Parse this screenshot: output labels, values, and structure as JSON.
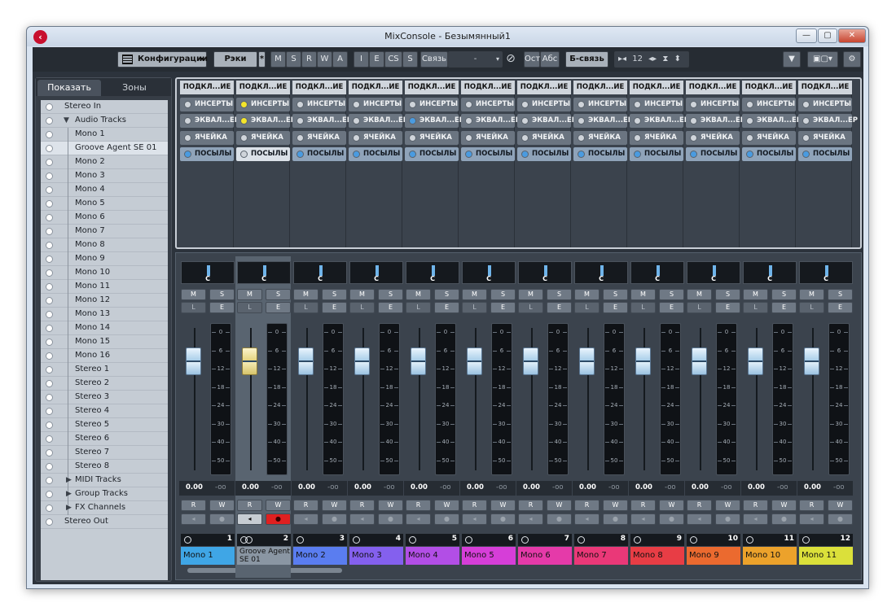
{
  "window": {
    "title": "MixConsole - Безымянный1"
  },
  "toolbar": {
    "config_label": "Конфигурации",
    "racks_label": "Рэки",
    "star": "*",
    "m": "M",
    "s": "S",
    "r": "R",
    "w": "W",
    "a": "A",
    "i": "I",
    "e": "E",
    "cs": "CS",
    "s2": "S",
    "link_label": "Связь",
    "link_value": "-",
    "ost_label": "Ост",
    "abs_label": "Абс",
    "b_link_label": "Б-связь",
    "width_value": "12"
  },
  "left_panel": {
    "tabs": [
      "Показать",
      "Зоны"
    ],
    "active_tab": 0,
    "items": [
      {
        "label": "Stereo In",
        "level": 0
      },
      {
        "label": "Audio Tracks",
        "level": 0,
        "expanded": true
      },
      {
        "label": "Mono 1",
        "level": 1
      },
      {
        "label": "Groove Agent SE 01",
        "level": 1,
        "selected": true
      },
      {
        "label": "Mono 2",
        "level": 1
      },
      {
        "label": "Mono 3",
        "level": 1
      },
      {
        "label": "Mono 4",
        "level": 1
      },
      {
        "label": "Mono 5",
        "level": 1
      },
      {
        "label": "Mono 6",
        "level": 1
      },
      {
        "label": "Mono 7",
        "level": 1
      },
      {
        "label": "Mono 8",
        "level": 1
      },
      {
        "label": "Mono 9",
        "level": 1
      },
      {
        "label": "Mono 10",
        "level": 1
      },
      {
        "label": "Mono 11",
        "level": 1
      },
      {
        "label": "Mono 12",
        "level": 1
      },
      {
        "label": "Mono 13",
        "level": 1
      },
      {
        "label": "Mono 14",
        "level": 1
      },
      {
        "label": "Mono 15",
        "level": 1
      },
      {
        "label": "Mono 16",
        "level": 1
      },
      {
        "label": "Stereo 1",
        "level": 1
      },
      {
        "label": "Stereo 2",
        "level": 1
      },
      {
        "label": "Stereo 3",
        "level": 1
      },
      {
        "label": "Stereo 4",
        "level": 1
      },
      {
        "label": "Stereo 5",
        "level": 1
      },
      {
        "label": "Stereo 6",
        "level": 1
      },
      {
        "label": "Stereo 7",
        "level": 1
      },
      {
        "label": "Stereo 8",
        "level": 1
      },
      {
        "label": "MIDI Tracks",
        "level": 1,
        "collapsed": true
      },
      {
        "label": "Group Tracks",
        "level": 1,
        "collapsed": true
      },
      {
        "label": "FX Channels",
        "level": 1,
        "collapsed": true
      },
      {
        "label": "Stereo Out",
        "level": 0
      }
    ]
  },
  "racks": {
    "routing": "ПОДКЛ...ИЕ",
    "inserts": "ИНСЕРТЫ",
    "eq": "ЭКВАЛ...ЕР",
    "strip": "ЯЧЕЙКА",
    "sends": "ПОСЫЛЫ"
  },
  "channel_common": {
    "pan_label": "C",
    "m": "M",
    "s": "S",
    "l": "L",
    "e": "E",
    "r": "R",
    "w": "W",
    "volume": "0.00",
    "peak": "-oo",
    "meter_scale": [
      "0",
      "6",
      "12",
      "18",
      "24",
      "30",
      "40",
      "50"
    ]
  },
  "channels": [
    {
      "number": "1",
      "name": "Mono 1",
      "color": "#3fa6e6",
      "eq_led": "off",
      "insert_led": "off"
    },
    {
      "number": "2",
      "name": "Groove Agent SE 01",
      "color": "#8a96a3",
      "eq_led": "yellow",
      "insert_led": "yellow",
      "selected": true,
      "record": true,
      "instrument": true
    },
    {
      "number": "3",
      "name": "Mono 2",
      "color": "#5a7df0",
      "eq_led": "off",
      "insert_led": "off"
    },
    {
      "number": "4",
      "name": "Mono 3",
      "color": "#8460ee",
      "eq_led": "off",
      "insert_led": "off"
    },
    {
      "number": "5",
      "name": "Mono 4",
      "color": "#b24ee6",
      "eq_led": "blue",
      "insert_led": "off"
    },
    {
      "number": "6",
      "name": "Mono 5",
      "color": "#d63ed8",
      "eq_led": "off",
      "insert_led": "off"
    },
    {
      "number": "7",
      "name": "Mono 6",
      "color": "#e53aa9",
      "eq_led": "off",
      "insert_led": "off"
    },
    {
      "number": "8",
      "name": "Mono 7",
      "color": "#ea3878",
      "eq_led": "off",
      "insert_led": "off"
    },
    {
      "number": "9",
      "name": "Mono 8",
      "color": "#e83d45",
      "eq_led": "off",
      "insert_led": "off"
    },
    {
      "number": "10",
      "name": "Mono 9",
      "color": "#eb6a2f",
      "eq_led": "off",
      "insert_led": "off"
    },
    {
      "number": "11",
      "name": "Mono 10",
      "color": "#eca22b",
      "eq_led": "off",
      "insert_led": "off"
    },
    {
      "number": "12",
      "name": "Mono 11",
      "color": "#dbe03a",
      "eq_led": "off",
      "insert_led": "off"
    }
  ],
  "icons": {
    "app": "cubase-logo-icon",
    "minimize": "minimize-icon",
    "maximize": "maximize-icon",
    "close": "close-icon",
    "settings": "gear-icon"
  }
}
